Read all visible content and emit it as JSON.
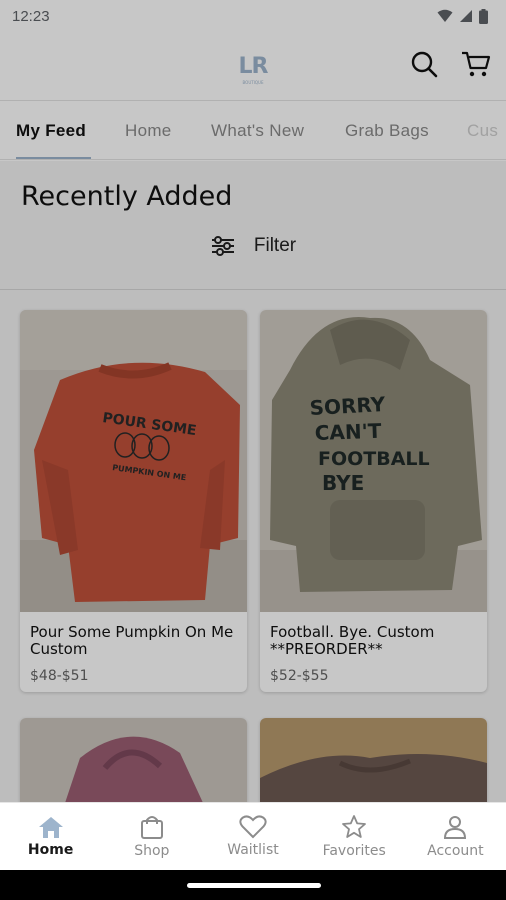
{
  "status_bar": {
    "time": "12:23"
  },
  "header": {
    "logo_text": "LR",
    "logo_subtext": "BOUTIQUE"
  },
  "tabs": [
    {
      "label": "My Feed",
      "active": true
    },
    {
      "label": "Home"
    },
    {
      "label": "What's New"
    },
    {
      "label": "Grab Bags"
    },
    {
      "label": "Cus"
    }
  ],
  "feed": {
    "title": "Recently Added",
    "filter_label": "Filter",
    "products": [
      {
        "name": "Pour Some Pumpkin On Me Custom",
        "price": "$48-$51",
        "print_text": [
          "POUR SOME",
          "PUMPKIN ON ME"
        ]
      },
      {
        "name": "Football. Bye. Custom **PREORDER**",
        "price": "$52-$55",
        "print_text": [
          "SORRY",
          "CAN'T",
          "FOOTBALL",
          "BYE"
        ]
      }
    ]
  },
  "bottom_nav": [
    {
      "label": "Home",
      "icon": "home-icon",
      "active": true
    },
    {
      "label": "Shop",
      "icon": "shopping-bag-icon"
    },
    {
      "label": "Waitlist",
      "icon": "heart-icon"
    },
    {
      "label": "Favorites",
      "icon": "star-icon"
    },
    {
      "label": "Account",
      "icon": "account-icon"
    }
  ],
  "colors": {
    "accent": "#9db4cc",
    "sweatshirt_orange": "#c0513a",
    "hoodie_olive": "#8c8877",
    "hoodie_mauve": "#9b5e73",
    "tee_brown": "#6e5a52"
  }
}
